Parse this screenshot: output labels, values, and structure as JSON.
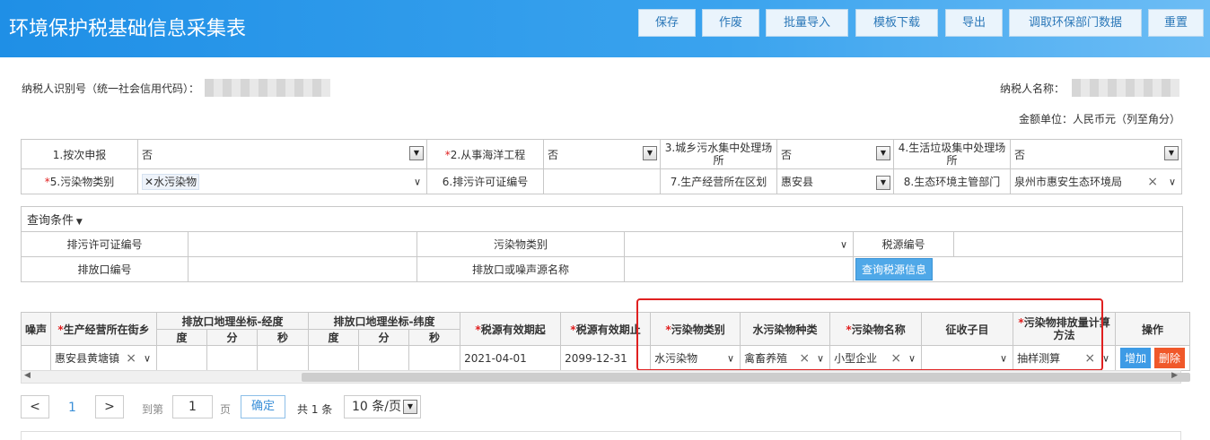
{
  "header": {
    "title": "环境保护税基础信息采集表",
    "buttons": [
      "保存",
      "作废",
      "批量导入",
      "模板下载",
      "导出",
      "调取环保部门数据",
      "重置"
    ]
  },
  "taxpayer": {
    "id_label": "纳税人识别号（统一社会信用代码）：",
    "name_label": "纳税人名称：",
    "unit": "金额单位：人民币元（列至角分）"
  },
  "form": {
    "f1_label": "1.按次申报",
    "f1_value": "否",
    "f2_label": "2.从事海洋工程",
    "f2_value": "否",
    "f3_label": "3.城乡污水集中处理场所",
    "f3_value": "否",
    "f4_label": "4.生活垃圾集中处理场所",
    "f4_value": "否",
    "f5_label": "5.污染物类别",
    "f5_value": "水污染物",
    "f6_label": "6.排污许可证编号",
    "f6_value": "",
    "f7_label": "7.生产经营所在区划",
    "f7_value": "惠安县",
    "f8_label": "8.生态环境主管部门",
    "f8_value": "泉州市惠安生态环境局"
  },
  "query": {
    "title": "查询条件",
    "permit_label": "排污许可证编号",
    "pollutant_type_label": "污染物类别",
    "tax_source_label": "税源编号",
    "outlet_label": "排放口编号",
    "outlet_name_label": "排放口或噪声源名称",
    "search_button": "查询税源信息"
  },
  "grid": {
    "headers": {
      "noise": "噪声",
      "street": "生产经营所在街乡",
      "lon": "排放口地理坐标-经度",
      "lat": "排放口地理坐标-纬度",
      "deg": "度",
      "min": "分",
      "sec": "秒",
      "start": "税源有效期起",
      "end": "税源有效期止",
      "ptype": "污染物类别",
      "wtype": "水污染物种类",
      "pname": "污染物名称",
      "item": "征收子目",
      "method": "污染物排放量计算方法",
      "op": "操作"
    },
    "row": {
      "street": "惠安县黄塘镇",
      "start": "2021-04-01",
      "end": "2099-12-31",
      "ptype": "水污染物",
      "wtype": "禽畜养殖",
      "pname": "小型企业",
      "item": "",
      "method": "抽样测算",
      "add": "增加",
      "del": "删除"
    }
  },
  "pager": {
    "prev": "<",
    "current": "1",
    "next": ">",
    "goto_label": "到第",
    "goto_value": "1",
    "page_label": "页",
    "confirm": "确定",
    "total": "共 1 条",
    "size": "10 条/页"
  },
  "colors": {
    "header": "#1f8fe6",
    "highlight_box": "#e02020",
    "add": "#3d9be6",
    "delete": "#f0582a"
  }
}
